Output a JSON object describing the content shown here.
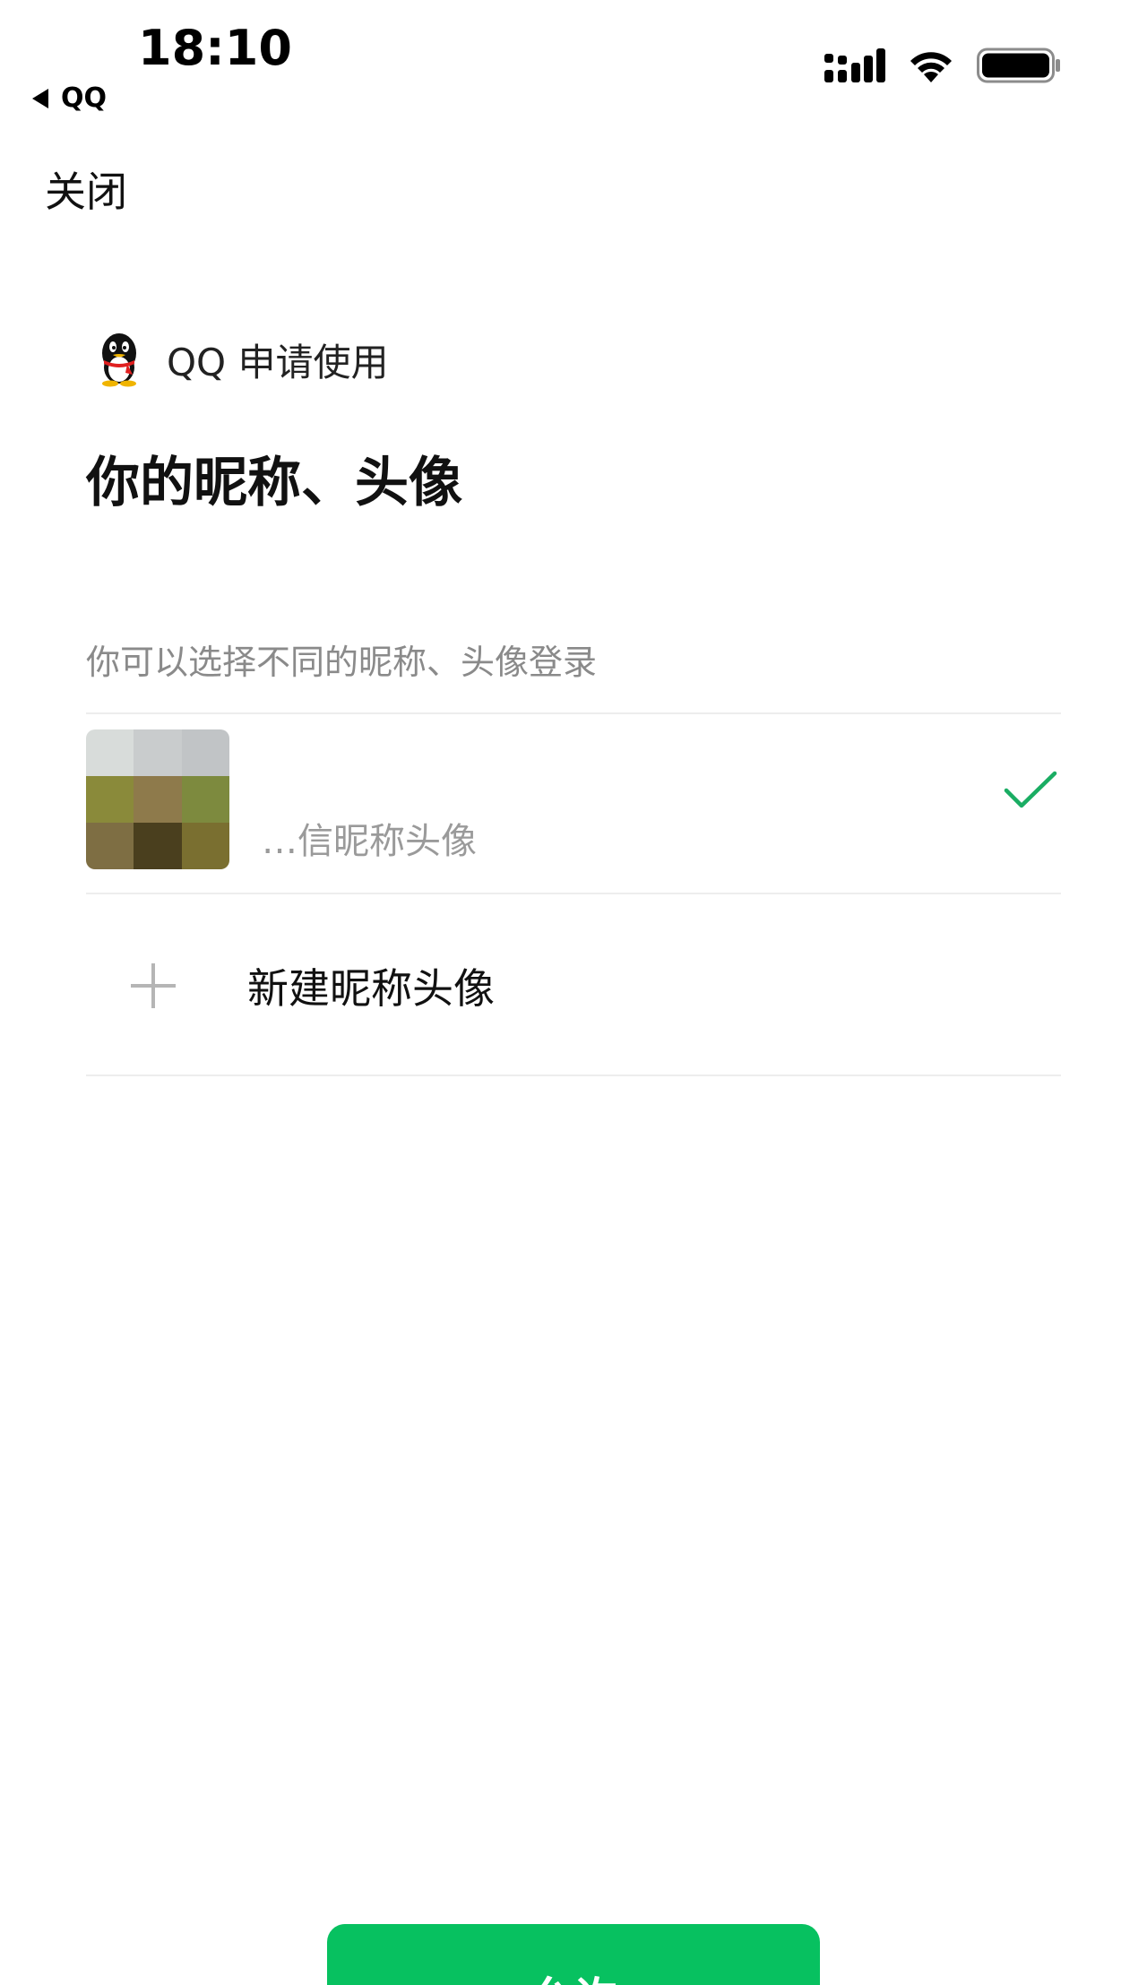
{
  "status_bar": {
    "time": "18:10",
    "back_app": "QQ",
    "icons": [
      "cellular-signal-icon",
      "wifi-icon",
      "battery-icon"
    ]
  },
  "header": {
    "close_label": "关闭"
  },
  "request": {
    "app_name": "QQ 申请使用",
    "app_icon": "qq-penguin-icon",
    "title": "你的昵称、头像",
    "hint": "你可以选择不同的昵称、头像登录"
  },
  "options": {
    "existing": {
      "label": "…信昵称头像",
      "selected": true,
      "avatar_pixel_colors": [
        "#d8dcda",
        "#c9cccd",
        "#c1c4c6",
        "#8a8a3a",
        "#8e7a4b",
        "#7d8a3e",
        "#7e6e43",
        "#4a3f1e",
        "#7a6f30"
      ]
    },
    "new": {
      "label": "新建昵称头像"
    }
  },
  "footer": {
    "allow_label": "允许"
  },
  "colors": {
    "accent_green": "#07c160",
    "check_green": "#1aad63"
  }
}
